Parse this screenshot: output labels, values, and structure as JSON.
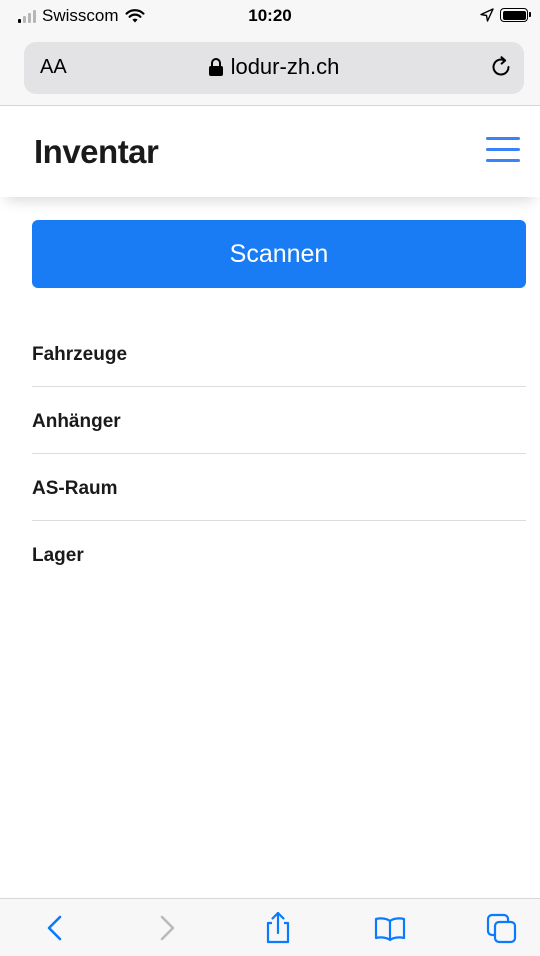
{
  "status_bar": {
    "carrier": "Swisscom",
    "time": "10:20"
  },
  "browser": {
    "aa_label": "AA",
    "url": "lodur-zh.ch"
  },
  "header": {
    "title": "Inventar"
  },
  "main": {
    "scan_label": "Scannen",
    "categories": [
      {
        "label": "Fahrzeuge"
      },
      {
        "label": "Anhänger"
      },
      {
        "label": "AS-Raum"
      },
      {
        "label": "Lager"
      }
    ]
  },
  "colors": {
    "accent": "#1a7cf5",
    "menu_icon": "#3b82f6",
    "toolbar_icon": "#0a7aff",
    "toolbar_icon_disabled": "#b9b9be"
  },
  "icons": {
    "menu": "hamburger-icon",
    "back": "chevron-left-icon",
    "forward": "chevron-right-icon",
    "share": "share-icon",
    "bookmarks": "book-icon",
    "tabs": "tabs-icon"
  }
}
